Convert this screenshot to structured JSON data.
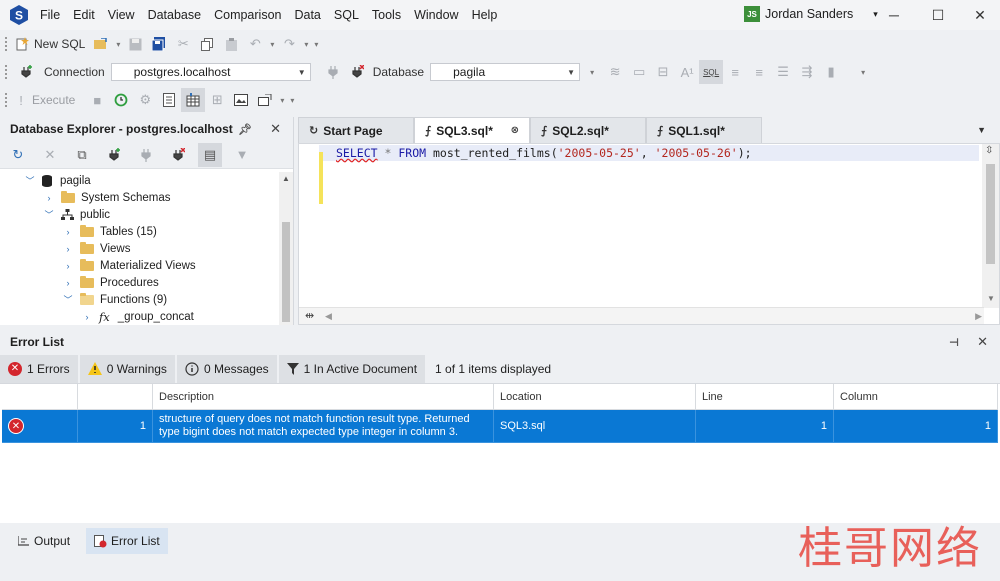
{
  "app": {
    "menu": [
      "File",
      "Edit",
      "View",
      "Database",
      "Comparison",
      "Data",
      "SQL",
      "Tools",
      "Window",
      "Help"
    ],
    "user_initials": "JS",
    "user_name": "Jordan Sanders",
    "brand_color": "#1f4fa3"
  },
  "toolbar1": {
    "new_sql": "New SQL"
  },
  "toolbar2": {
    "connection_label": "Connection",
    "connection_value": "postgres.localhost",
    "database_label": "Database",
    "database_value": "pagila",
    "sql_icon_text": "SQL"
  },
  "toolbar3": {
    "execute": "Execute"
  },
  "explorer": {
    "title": "Database Explorer - postgres.localhost",
    "tree": [
      {
        "label": "pagila",
        "icon": "database-icon"
      },
      {
        "label": "System Schemas",
        "icon": "folder-icon"
      },
      {
        "label": "public",
        "icon": "schema-icon"
      },
      {
        "label": "Tables (15)",
        "icon": "folder-icon"
      },
      {
        "label": "Views",
        "icon": "folder-icon"
      },
      {
        "label": "Materialized Views",
        "icon": "folder-icon"
      },
      {
        "label": "Procedures",
        "icon": "folder-icon"
      },
      {
        "label": "Functions (9)",
        "icon": "folder-open-icon"
      },
      {
        "label": "_group_concat",
        "icon": "function-icon"
      }
    ],
    "function_glyph": "fx"
  },
  "editor": {
    "tabs": [
      {
        "label": "Start Page"
      },
      {
        "label": "SQL3.sql*"
      },
      {
        "label": "SQL2.sql*"
      },
      {
        "label": "SQL1.sql*"
      }
    ],
    "code": {
      "kw_select": "SELECT",
      "star": "*",
      "kw_from": "FROM",
      "fn_call": "most_rented_films(",
      "arg1": "'2005-05-25'",
      "comma": ",",
      "arg2": "'2005-05-26'",
      "end": ");"
    }
  },
  "error_list": {
    "title": "Error List",
    "filters": {
      "errors": "1 Errors",
      "warnings": "0 Warnings",
      "messages": "0 Messages",
      "active_doc": "1 In Active Document",
      "displayed": "1 of 1 items displayed"
    },
    "columns": [
      "Description",
      "Location",
      "Line",
      "Column"
    ],
    "rows": [
      {
        "index": "1",
        "description": "structure of query does not match function result type. Returned type bigint does not match expected type integer in column 3.",
        "location": "SQL3.sql",
        "line": "1",
        "column": "1"
      }
    ]
  },
  "bottom_tabs": [
    "Output",
    "Error List"
  ],
  "watermark": "桂哥网络"
}
